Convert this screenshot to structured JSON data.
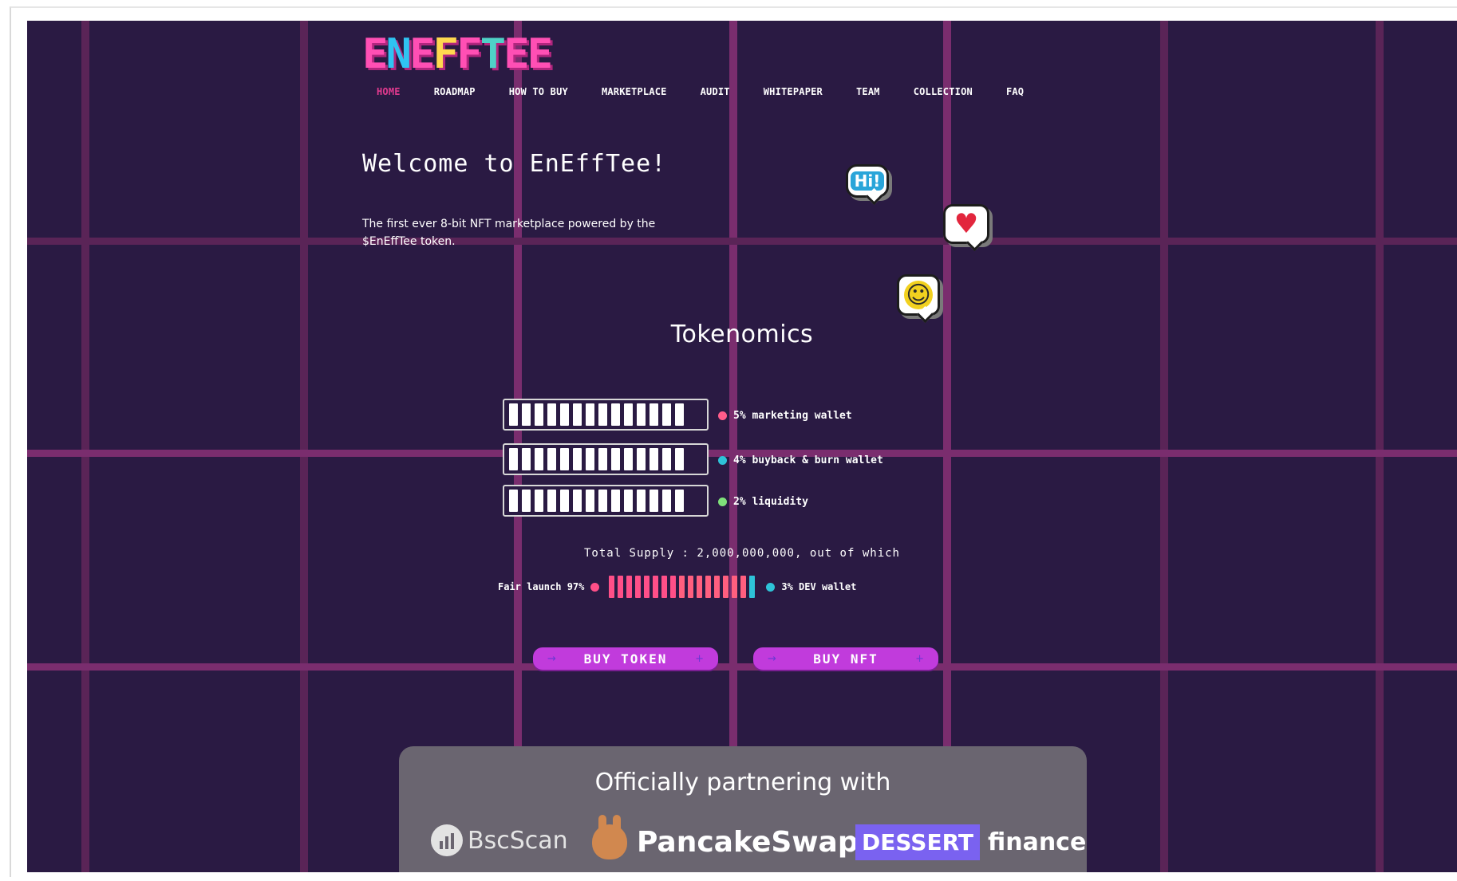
{
  "logo": {
    "text": "ENEFFTEE",
    "letters": [
      "E",
      "N",
      "E",
      "F",
      "F",
      "T",
      "E",
      "E"
    ],
    "colors": [
      "#ff4fb4",
      "#2fc4f2",
      "#ff4fb4",
      "#ffd84f",
      "#ff4fb4",
      "#4fd1c7",
      "#ff4fb4",
      "#ff4fb4"
    ]
  },
  "nav": {
    "items": [
      "HOME",
      "ROADMAP",
      "HOW TO BUY",
      "MARKETPLACE",
      "AUDIT",
      "WHITEPAPER",
      "TEAM",
      "COLLECTION",
      "FAQ"
    ],
    "active_index": 0,
    "active_color": "#e23a8f"
  },
  "hero": {
    "title": "Welcome to EnEffTee!",
    "subtitle": "The first ever 8-bit NFT marketplace powered by the $EnEffTee token."
  },
  "bubbles": {
    "hi": "Hi!",
    "heart": "♥",
    "smile": "☺"
  },
  "tokenomics": {
    "title": "Tokenomics",
    "rows": [
      {
        "label": "5% marketing wallet",
        "dot_color": "#ff5c8a",
        "percent": 100
      },
      {
        "label": "4% buyback & burn wallet",
        "dot_color": "#2ec3d8",
        "percent": 100
      },
      {
        "label": "2% liquidity",
        "dot_color": "#7fe07a",
        "percent": 100
      }
    ],
    "supply_text": "Total Supply : 2,000,000,000, out of which",
    "launch": {
      "left_label": "Fair launch 97%",
      "left_dot": "#ff4f88",
      "right_label": "3% DEV wallet",
      "right_dot": "#2ec3d8",
      "fair_percent": 97
    }
  },
  "buttons": {
    "token": "BUY TOKEN",
    "nft": "BUY NFT",
    "arrow_left": "→",
    "arrow_right": "+"
  },
  "partners": {
    "title": "Officially partnering with",
    "bscscan": "BscScan",
    "pancakeswap": "PancakeSwap",
    "dessert": "DESSERT",
    "finance": "finance"
  }
}
